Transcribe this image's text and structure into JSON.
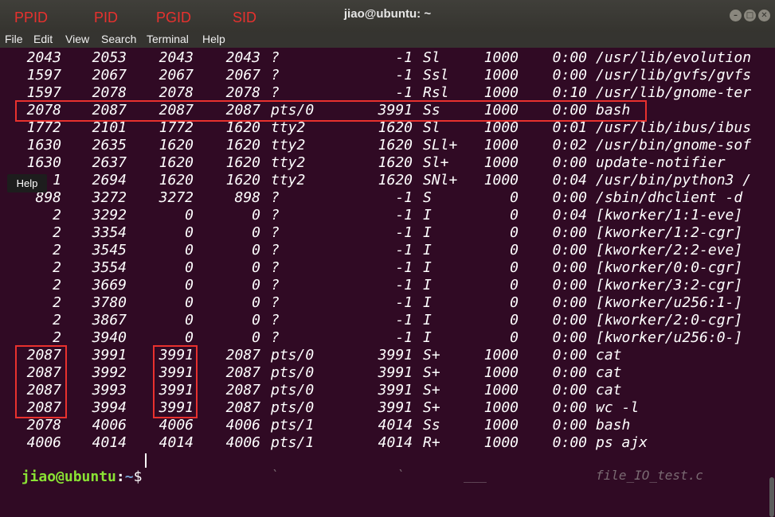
{
  "window": {
    "title": "jiao@ubuntu: ~",
    "controls": [
      "minimize-icon",
      "maximize-icon",
      "close-icon"
    ]
  },
  "annotations": {
    "headers": [
      "PPID",
      "PID",
      "PGID",
      "SID"
    ],
    "color": "#e8312e"
  },
  "menu": [
    "File",
    "Edit",
    "View",
    "Search",
    "Terminal",
    "Help"
  ],
  "tooltip": "Help",
  "rows": [
    {
      "ppid": "2043",
      "pid": "2053",
      "pgid": "2043",
      "sid": "2043",
      "tty": "?",
      "tpgid": "-1",
      "stat": "Sl",
      "uid": "1000",
      "time": "0:00",
      "cmd": "/usr/lib/evolution"
    },
    {
      "ppid": "1597",
      "pid": "2067",
      "pgid": "2067",
      "sid": "2067",
      "tty": "?",
      "tpgid": "-1",
      "stat": "Ssl",
      "uid": "1000",
      "time": "0:00",
      "cmd": "/usr/lib/gvfs/gvfs"
    },
    {
      "ppid": "1597",
      "pid": "2078",
      "pgid": "2078",
      "sid": "2078",
      "tty": "?",
      "tpgid": "-1",
      "stat": "Rsl",
      "uid": "1000",
      "time": "0:10",
      "cmd": "/usr/lib/gnome-ter"
    },
    {
      "ppid": "2078",
      "pid": "2087",
      "pgid": "2087",
      "sid": "2087",
      "tty": "pts/0",
      "tpgid": "3991",
      "stat": "Ss",
      "uid": "1000",
      "time": "0:00",
      "cmd": "bash"
    },
    {
      "ppid": "1772",
      "pid": "2101",
      "pgid": "1772",
      "sid": "1620",
      "tty": "tty2",
      "tpgid": "1620",
      "stat": "Sl",
      "uid": "1000",
      "time": "0:01",
      "cmd": "/usr/lib/ibus/ibus"
    },
    {
      "ppid": "1630",
      "pid": "2635",
      "pgid": "1620",
      "sid": "1620",
      "tty": "tty2",
      "tpgid": "1620",
      "stat": "SLl+",
      "uid": "1000",
      "time": "0:02",
      "cmd": "/usr/bin/gnome-sof"
    },
    {
      "ppid": "1630",
      "pid": "2637",
      "pgid": "1620",
      "sid": "1620",
      "tty": "tty2",
      "tpgid": "1620",
      "stat": "Sl+",
      "uid": "1000",
      "time": "0:00",
      "cmd": "update-notifier"
    },
    {
      "ppid": "1",
      "pid": "2694",
      "pgid": "1620",
      "sid": "1620",
      "tty": "tty2",
      "tpgid": "1620",
      "stat": "SNl+",
      "uid": "1000",
      "time": "0:04",
      "cmd": "/usr/bin/python3 /"
    },
    {
      "ppid": "898",
      "pid": "3272",
      "pgid": "3272",
      "sid": "898",
      "tty": "?",
      "tpgid": "-1",
      "stat": "S",
      "uid": "0",
      "time": "0:00",
      "cmd": "/sbin/dhclient -d"
    },
    {
      "ppid": "2",
      "pid": "3292",
      "pgid": "0",
      "sid": "0",
      "tty": "?",
      "tpgid": "-1",
      "stat": "I",
      "uid": "0",
      "time": "0:04",
      "cmd": "[kworker/1:1-eve]"
    },
    {
      "ppid": "2",
      "pid": "3354",
      "pgid": "0",
      "sid": "0",
      "tty": "?",
      "tpgid": "-1",
      "stat": "I",
      "uid": "0",
      "time": "0:00",
      "cmd": "[kworker/1:2-cgr]"
    },
    {
      "ppid": "2",
      "pid": "3545",
      "pgid": "0",
      "sid": "0",
      "tty": "?",
      "tpgid": "-1",
      "stat": "I",
      "uid": "0",
      "time": "0:00",
      "cmd": "[kworker/2:2-eve]"
    },
    {
      "ppid": "2",
      "pid": "3554",
      "pgid": "0",
      "sid": "0",
      "tty": "?",
      "tpgid": "-1",
      "stat": "I",
      "uid": "0",
      "time": "0:00",
      "cmd": "[kworker/0:0-cgr]"
    },
    {
      "ppid": "2",
      "pid": "3669",
      "pgid": "0",
      "sid": "0",
      "tty": "?",
      "tpgid": "-1",
      "stat": "I",
      "uid": "0",
      "time": "0:00",
      "cmd": "[kworker/3:2-cgr]"
    },
    {
      "ppid": "2",
      "pid": "3780",
      "pgid": "0",
      "sid": "0",
      "tty": "?",
      "tpgid": "-1",
      "stat": "I",
      "uid": "0",
      "time": "0:00",
      "cmd": "[kworker/u256:1-]"
    },
    {
      "ppid": "2",
      "pid": "3867",
      "pgid": "0",
      "sid": "0",
      "tty": "?",
      "tpgid": "-1",
      "stat": "I",
      "uid": "0",
      "time": "0:00",
      "cmd": "[kworker/2:0-cgr]"
    },
    {
      "ppid": "2",
      "pid": "3940",
      "pgid": "0",
      "sid": "0",
      "tty": "?",
      "tpgid": "-1",
      "stat": "I",
      "uid": "0",
      "time": "0:00",
      "cmd": "[kworker/u256:0-]"
    },
    {
      "ppid": "2087",
      "pid": "3991",
      "pgid": "3991",
      "sid": "2087",
      "tty": "pts/0",
      "tpgid": "3991",
      "stat": "S+",
      "uid": "1000",
      "time": "0:00",
      "cmd": "cat"
    },
    {
      "ppid": "2087",
      "pid": "3992",
      "pgid": "3991",
      "sid": "2087",
      "tty": "pts/0",
      "tpgid": "3991",
      "stat": "S+",
      "uid": "1000",
      "time": "0:00",
      "cmd": "cat"
    },
    {
      "ppid": "2087",
      "pid": "3993",
      "pgid": "3991",
      "sid": "2087",
      "tty": "pts/0",
      "tpgid": "3991",
      "stat": "S+",
      "uid": "1000",
      "time": "0:00",
      "cmd": "cat"
    },
    {
      "ppid": "2087",
      "pid": "3994",
      "pgid": "3991",
      "sid": "2087",
      "tty": "pts/0",
      "tpgid": "3991",
      "stat": "S+",
      "uid": "1000",
      "time": "0:00",
      "cmd": "wc -l"
    },
    {
      "ppid": "2078",
      "pid": "4006",
      "pgid": "4006",
      "sid": "4006",
      "tty": "pts/1",
      "tpgid": "4014",
      "stat": "Ss",
      "uid": "1000",
      "time": "0:00",
      "cmd": "bash"
    },
    {
      "ppid": "4006",
      "pid": "4014",
      "pgid": "4014",
      "sid": "4006",
      "tty": "pts/1",
      "tpgid": "4014",
      "stat": "R+",
      "uid": "1000",
      "time": "0:00",
      "cmd": "ps ajx"
    }
  ],
  "prompt": {
    "user_host": "jiao@ubuntu",
    "separator": ":",
    "path": "~",
    "symbol": "$"
  },
  "ghost_text": [
    "`",
    "`",
    "___",
    "file_IO_test.c"
  ]
}
